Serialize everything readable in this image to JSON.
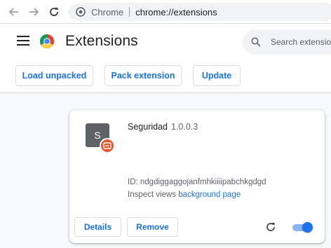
{
  "browser": {
    "site_label": "Chrome",
    "url": "chrome://extensions"
  },
  "header": {
    "title": "Extensions",
    "search_placeholder": "Search extensions"
  },
  "dev_buttons": {
    "load_unpacked": "Load unpacked",
    "pack_extension": "Pack extension",
    "update": "Update"
  },
  "extension": {
    "icon_letter": "S",
    "name": "Seguridad",
    "version": "1.0.0.3",
    "id_label": "ID: ",
    "id": "ndgdiggaggojanfmhkiiiipabchkgdgd",
    "inspect_label": "Inspect views ",
    "inspect_link": "background page",
    "details_label": "Details",
    "remove_label": "Remove",
    "enabled": true
  },
  "colors": {
    "accent": "#1a73e8",
    "badge": "#e8582c",
    "toggle_track": "#8ab4f8"
  },
  "icons": [
    "back-arrow-icon",
    "forward-arrow-icon",
    "reload-icon",
    "chrome-site-icon",
    "menu-icon",
    "chrome-logo-icon",
    "search-icon",
    "extension-badge-icon",
    "reload-extension-icon"
  ]
}
